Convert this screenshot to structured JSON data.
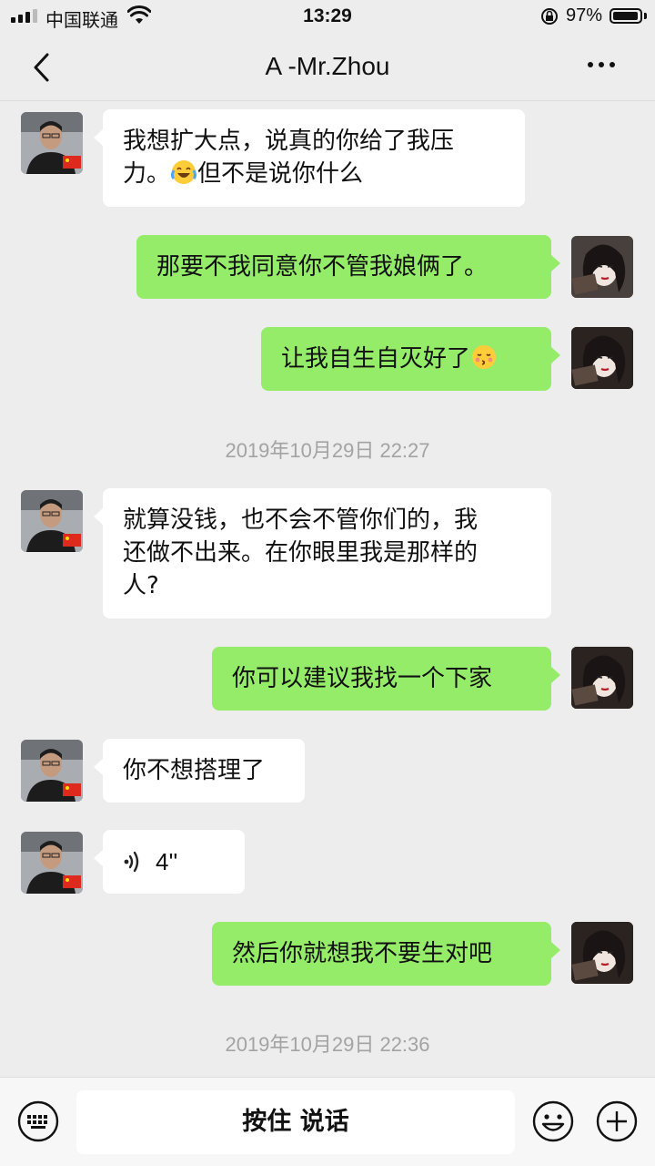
{
  "status_bar": {
    "carrier": "中国联通",
    "time": "13:29",
    "battery_text": "97%",
    "battery_level": 0.97
  },
  "nav": {
    "title": "A -Mr.Zhou",
    "back_icon": "chevron-left-icon",
    "more_icon": "more-dots-icon"
  },
  "messages": [
    {
      "side": "in",
      "lines": [
        "我想扩大点，说真的你给了我压",
        "力。"
      ],
      "tail": "但不是说你什么",
      "emoji": "laughing-crying-emoji"
    },
    {
      "side": "out",
      "text": "那要不我同意你不管我娘俩了。"
    },
    {
      "side": "out",
      "text": "让我自生自灭好了",
      "emoji": "kissing-face-emoji"
    },
    {
      "side": "in",
      "lines": [
        "就算没钱，也不会不管你们的，我",
        "还做不出来。在你眼里我是那样的",
        "人?"
      ]
    },
    {
      "side": "out",
      "text": "你可以建议我找一个下家"
    },
    {
      "side": "in",
      "text": "你不想搭理了"
    },
    {
      "side": "in",
      "voice_duration": "4''",
      "voice_icon": "voice-wave-icon"
    },
    {
      "side": "out",
      "text": "然后你就想我不要生对吧"
    }
  ],
  "timestamps": [
    "2019年10月29日 22:27",
    "2019年10月29日 22:36"
  ],
  "input_bar": {
    "hold_to_talk_label": "按住 说话",
    "keyboard_icon": "keyboard-icon",
    "emoji_icon": "emoji-face-icon",
    "plus_icon": "plus-circle-icon"
  },
  "colors": {
    "background": "#ededed",
    "outgoing_bubble": "#95ec69",
    "incoming_bubble": "#ffffff",
    "timestamp": "#a3a3a3"
  }
}
